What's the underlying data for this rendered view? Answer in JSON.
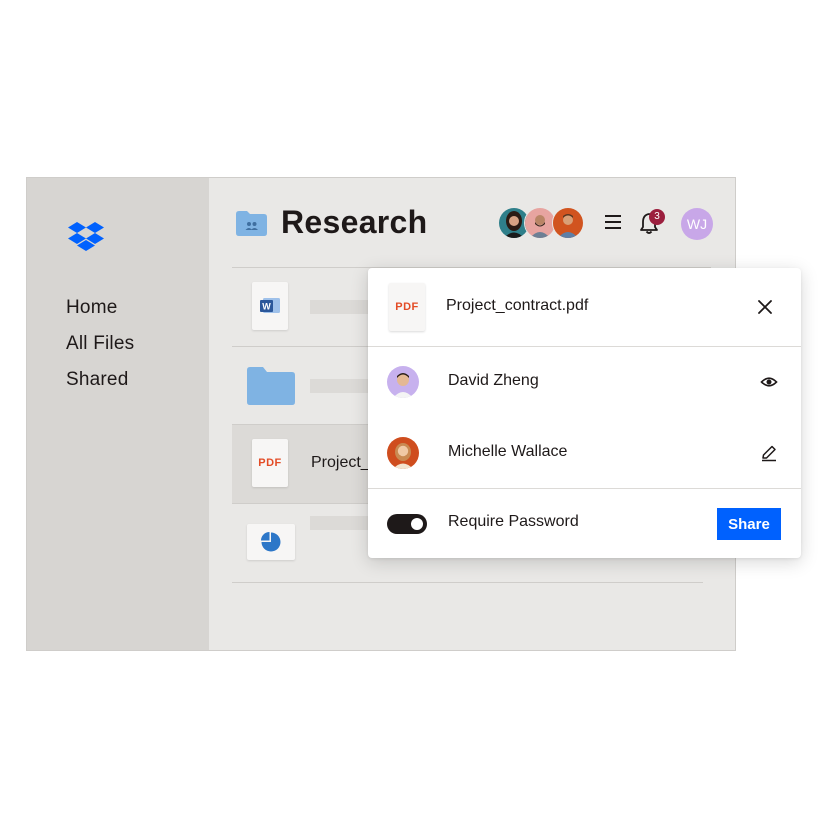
{
  "sidebar": {
    "logo": "dropbox-logo",
    "items": [
      {
        "label": "Home"
      },
      {
        "label": "All Files"
      },
      {
        "label": "Shared"
      }
    ]
  },
  "header": {
    "folder_icon": "shared-folder-icon",
    "title": "Research",
    "notification_count": "3",
    "user_initials": "WJ"
  },
  "files": [
    {
      "type": "word-doc",
      "name": ""
    },
    {
      "type": "folder",
      "name": ""
    },
    {
      "type": "pdf",
      "thumb_label": "PDF",
      "name": "Project_"
    },
    {
      "type": "chart",
      "name": ""
    }
  ],
  "share_panel": {
    "file_thumb_label": "PDF",
    "file_name": "Project_contract.pdf",
    "people": [
      {
        "name": "David Zheng",
        "permission_icon": "eye-icon"
      },
      {
        "name": "Michelle Wallace",
        "permission_icon": "pencil-icon"
      }
    ],
    "require_password_label": "Require Password",
    "require_password_on": true,
    "share_label": "Share"
  },
  "colors": {
    "accent": "#0061fe",
    "pdf": "#e34c26",
    "badge": "#9c1f3e",
    "user_avatar": "#c8a7e8",
    "folder": "#7fb3e3"
  }
}
